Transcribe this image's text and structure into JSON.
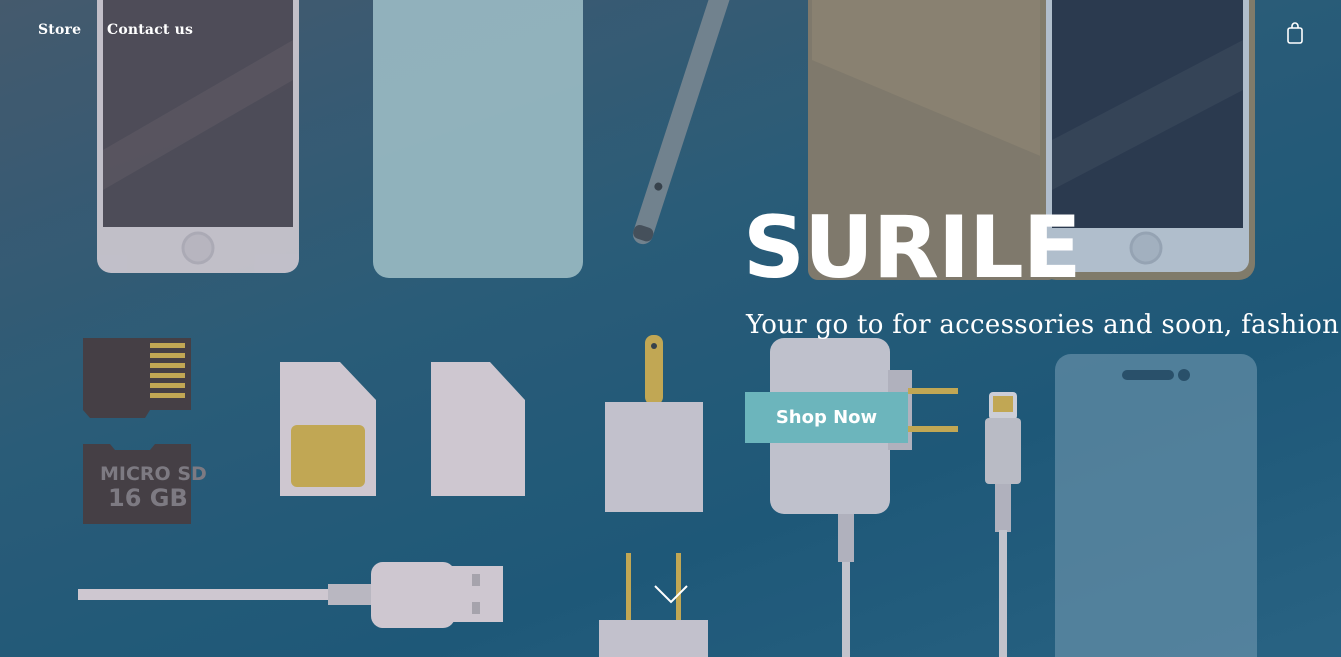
{
  "nav": {
    "items": [
      {
        "label": "Store"
      },
      {
        "label": "Contact us"
      }
    ],
    "cart_icon": "shopping-bag-icon"
  },
  "hero": {
    "brand": "SURILE",
    "tagline": "Your go to for accessories and soon, fashion.",
    "cta_label": "Shop Now",
    "scroll_icon": "chevron-down-icon",
    "illustration": {
      "memory_card_label_1": "MICRO SD",
      "memory_card_label_2": "16 GB"
    }
  },
  "colors": {
    "button": "#6cb5bc",
    "background_dark": "#1e5878"
  }
}
